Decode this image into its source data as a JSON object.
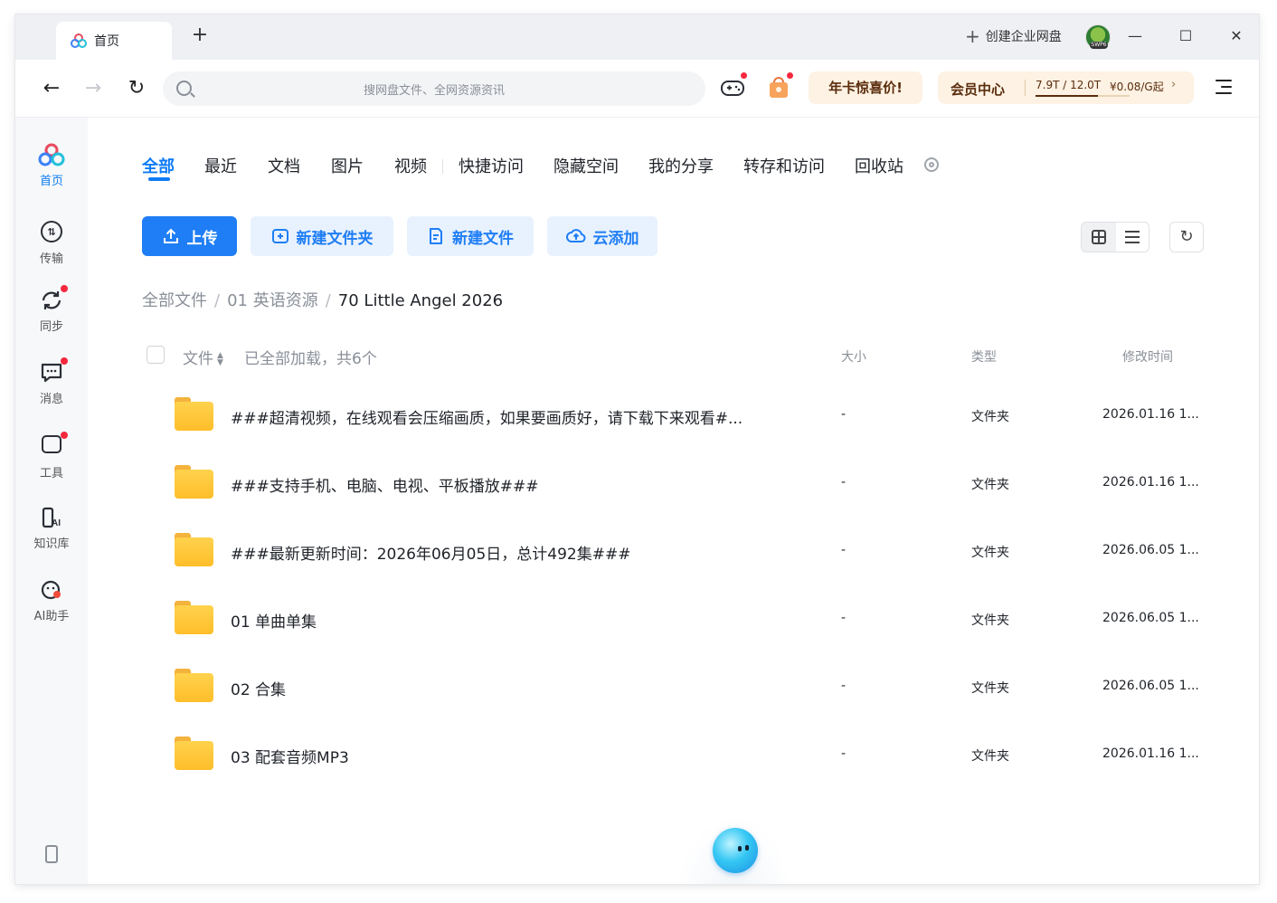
{
  "titlebar": {
    "tab_label": "首页",
    "new_tab_symbol": "+",
    "enterprise_label": "创建企业网盘",
    "avatar_badge": "SWP6",
    "window_controls": [
      "minimize-icon",
      "maximize-icon",
      "close-icon"
    ]
  },
  "toolbar": {
    "search_placeholder": "搜网盘文件、全网资源资讯",
    "promo_label": "年卡惊喜价!",
    "vip": {
      "title": "会员中心",
      "quota": "7.9T / 12.0T",
      "quota_fraction": 0.66,
      "price": "¥0.08/G起"
    }
  },
  "sidebar": {
    "items": [
      {
        "label": "首页",
        "icon": "home-logo-icon"
      },
      {
        "label": "传输",
        "icon": "transfer-icon"
      },
      {
        "label": "同步",
        "icon": "sync-icon"
      },
      {
        "label": "消息",
        "icon": "message-icon"
      },
      {
        "label": "工具",
        "icon": "toolbox-icon"
      },
      {
        "label": "知识库",
        "icon": "knowledge-base-icon"
      },
      {
        "label": "AI助手",
        "icon": "ai-assistant-icon"
      }
    ]
  },
  "categories": [
    "全部",
    "最近",
    "文档",
    "图片",
    "视频",
    "快捷访问",
    "隐藏空间",
    "我的分享",
    "转存和访问",
    "回收站"
  ],
  "actions": {
    "upload": "上传",
    "new_folder": "新建文件夹",
    "new_file": "新建文件",
    "cloud_add": "云添加"
  },
  "breadcrumb": {
    "items": [
      "全部文件",
      "01 英语资源"
    ],
    "current": "70 Little Angel 2026",
    "separator": "/"
  },
  "table": {
    "col_file": "文件",
    "loaded_status": "已全部加载，共6个",
    "col_size": "大小",
    "col_type": "类型",
    "col_modified": "修改时间",
    "rows": [
      {
        "name": "###超清视频，在线观看会压缩画质，如果要画质好，请下载下来观看#...",
        "size": "-",
        "type": "文件夹",
        "modified": "2026.01.16 1..."
      },
      {
        "name": "###支持手机、电脑、电视、平板播放###",
        "size": "-",
        "type": "文件夹",
        "modified": "2026.01.16 1..."
      },
      {
        "name": "###最新更新时间：2026年06月05日，总计492集###",
        "size": "-",
        "type": "文件夹",
        "modified": "2026.06.05 1..."
      },
      {
        "name": "01 单曲单集",
        "size": "-",
        "type": "文件夹",
        "modified": "2026.06.05 1..."
      },
      {
        "name": "02 合集",
        "size": "-",
        "type": "文件夹",
        "modified": "2026.06.05 1..."
      },
      {
        "name": "03 配套音频MP3",
        "size": "-",
        "type": "文件夹",
        "modified": "2026.01.16 1..."
      }
    ]
  },
  "colors": {
    "accent": "#1f7ef5",
    "accent_light": "#e8f2fe",
    "promo_bg": "#fdf2e3",
    "promo_text": "#5a2c0d",
    "badge_red": "#f5283d",
    "folder_yellow": "#ffc83a"
  }
}
